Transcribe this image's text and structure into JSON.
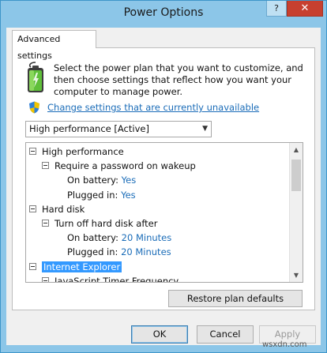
{
  "window": {
    "title": "Power Options",
    "help_label": "?",
    "close_label": "✕"
  },
  "tab": {
    "label": "Advanced settings"
  },
  "description": "Select the power plan that you want to customize, and then choose settings that reflect how you want your computer to manage power.",
  "change_link": "Change settings that are currently unavailable",
  "plan_select": {
    "value": "High performance [Active]"
  },
  "tree": {
    "items": [
      {
        "label": "High performance",
        "level": 0,
        "type": "group"
      },
      {
        "label": "Require a password on wakeup",
        "level": 1,
        "type": "group"
      },
      {
        "label": "On battery:",
        "value": "Yes",
        "level": 2,
        "type": "setting"
      },
      {
        "label": "Plugged in:",
        "value": "Yes",
        "level": 2,
        "type": "setting"
      },
      {
        "label": "Hard disk",
        "level": 0,
        "type": "group"
      },
      {
        "label": "Turn off hard disk after",
        "level": 1,
        "type": "group"
      },
      {
        "label": "On battery:",
        "value": "20 Minutes",
        "level": 2,
        "type": "setting"
      },
      {
        "label": "Plugged in:",
        "value": "20 Minutes",
        "level": 2,
        "type": "setting"
      },
      {
        "label": "Internet Explorer",
        "level": 0,
        "type": "group",
        "selected": true
      },
      {
        "label": "JavaScript Timer Frequency",
        "level": 1,
        "type": "group"
      }
    ]
  },
  "buttons": {
    "restore": "Restore plan defaults",
    "ok": "OK",
    "cancel": "Cancel",
    "apply": "Apply"
  },
  "watermark": "wsxdn.com",
  "colors": {
    "title_bar": "#8cc6e8",
    "link": "#1a6cb8",
    "selection": "#3399ff",
    "close_button": "#c7402f"
  }
}
